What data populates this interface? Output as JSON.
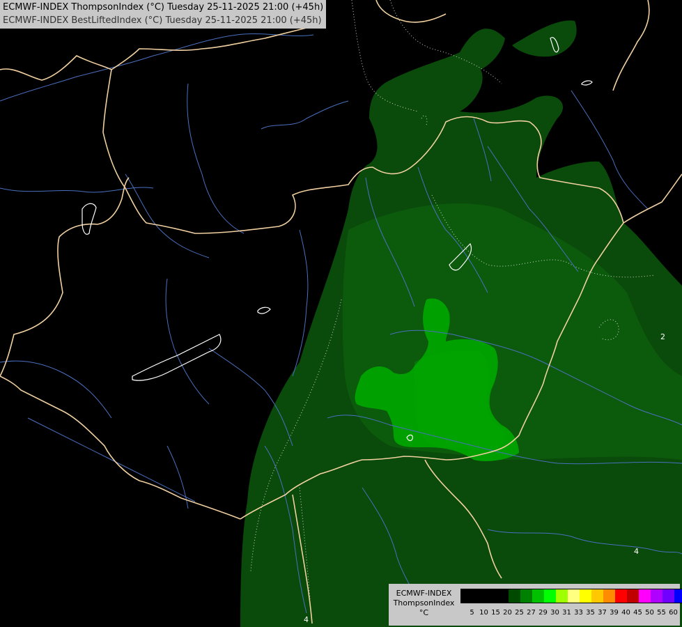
{
  "header": {
    "line1": "ECMWF-INDEX ThompsonIndex (°C) Tuesday 25-11-2025 21:00 (+45h)",
    "line2": "ECMWF-INDEX BestLiftedIndex (°C) Tuesday 25-11-2025 21:00 (+45h)"
  },
  "legend": {
    "model": "ECMWF-INDEX",
    "parameter": "ThompsonIndex",
    "unit": "°C",
    "labels": [
      "5",
      "10",
      "15",
      "20",
      "25",
      "27",
      "29",
      "30",
      "31",
      "33",
      "35",
      "37",
      "39",
      "40",
      "45",
      "50",
      "55",
      "60"
    ],
    "colors": [
      "#000000",
      "#000000",
      "#000000",
      "#000000",
      "#004a00",
      "#008000",
      "#00c000",
      "#00ff00",
      "#a0ff00",
      "#ffff80",
      "#ffff00",
      "#ffc800",
      "#ff8c00",
      "#ff0000",
      "#c00000",
      "#ff00ff",
      "#b000ff",
      "#7000ff",
      "#0000ff"
    ]
  },
  "contour_labels": [
    "2",
    "4",
    "4"
  ],
  "colors": {
    "background": "#000000",
    "field_25": "#0a4a0a",
    "field_27": "#0f6a0f",
    "field_29": "#00a000",
    "field_30": "#00c000",
    "border": "#f0d0a0",
    "river": "#4a70c0",
    "lake_outline": "#ffffff"
  }
}
